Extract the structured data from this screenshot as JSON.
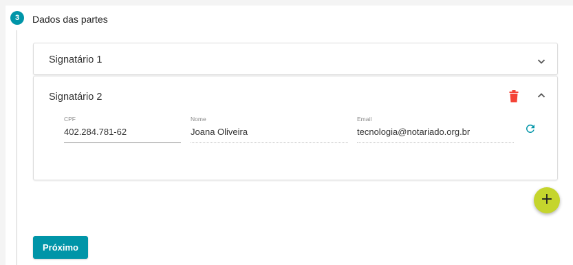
{
  "step": {
    "number": "3",
    "title": "Dados das partes"
  },
  "signatarios": [
    {
      "title": "Signatário 1",
      "expanded": false
    },
    {
      "title": "Signatário 2",
      "expanded": true,
      "fields": {
        "cpf": {
          "label": "CPF",
          "value": "402.284.781-62"
        },
        "nome": {
          "label": "Nome",
          "value": "Joana Oliveira"
        },
        "email": {
          "label": "Email",
          "value": "tecnologia@notariado.org.br"
        }
      }
    }
  ],
  "icons": {
    "expand": "chevron-down-icon",
    "collapse": "chevron-up-icon",
    "delete": "trash-icon",
    "refresh": "refresh-icon",
    "add": "plus-icon"
  },
  "fab": {
    "label": "+"
  },
  "actions": {
    "next_label": "Próximo"
  },
  "colors": {
    "primary": "#0095a8",
    "fab": "#c5d52d",
    "danger": "#f44336"
  }
}
